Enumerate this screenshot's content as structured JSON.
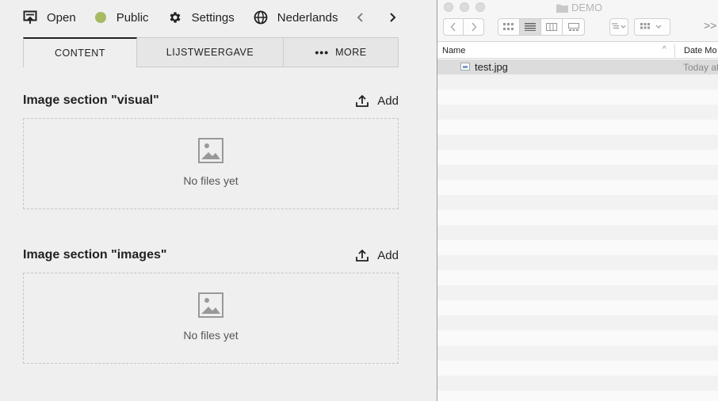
{
  "cms": {
    "toolbar": {
      "open_label": "Open",
      "status_label": "Public",
      "status_color": "#a7bb63",
      "settings_label": "Settings",
      "language_label": "Nederlands",
      "icons": [
        "open-icon",
        "status-dot",
        "gear-icon",
        "globe-icon",
        "chevron-left-icon",
        "chevron-right-icon"
      ]
    },
    "tabs": [
      {
        "label": "CONTENT",
        "active": true
      },
      {
        "label": "LIJSTWEERGAVE",
        "active": false
      },
      {
        "label": "MORE",
        "active": false
      }
    ],
    "sections": [
      {
        "title": "Image section \"visual\"",
        "add_label": "Add",
        "empty_text": "No files yet"
      },
      {
        "title": "Image section \"images\"",
        "add_label": "Add",
        "empty_text": "No files yet"
      }
    ]
  },
  "finder": {
    "window_title": "DEMO",
    "columns": {
      "name": "Name",
      "date": "Date Mo"
    },
    "files": [
      {
        "name": "test.jpg",
        "date": "Today at"
      }
    ],
    "overflow_label": ">>"
  }
}
